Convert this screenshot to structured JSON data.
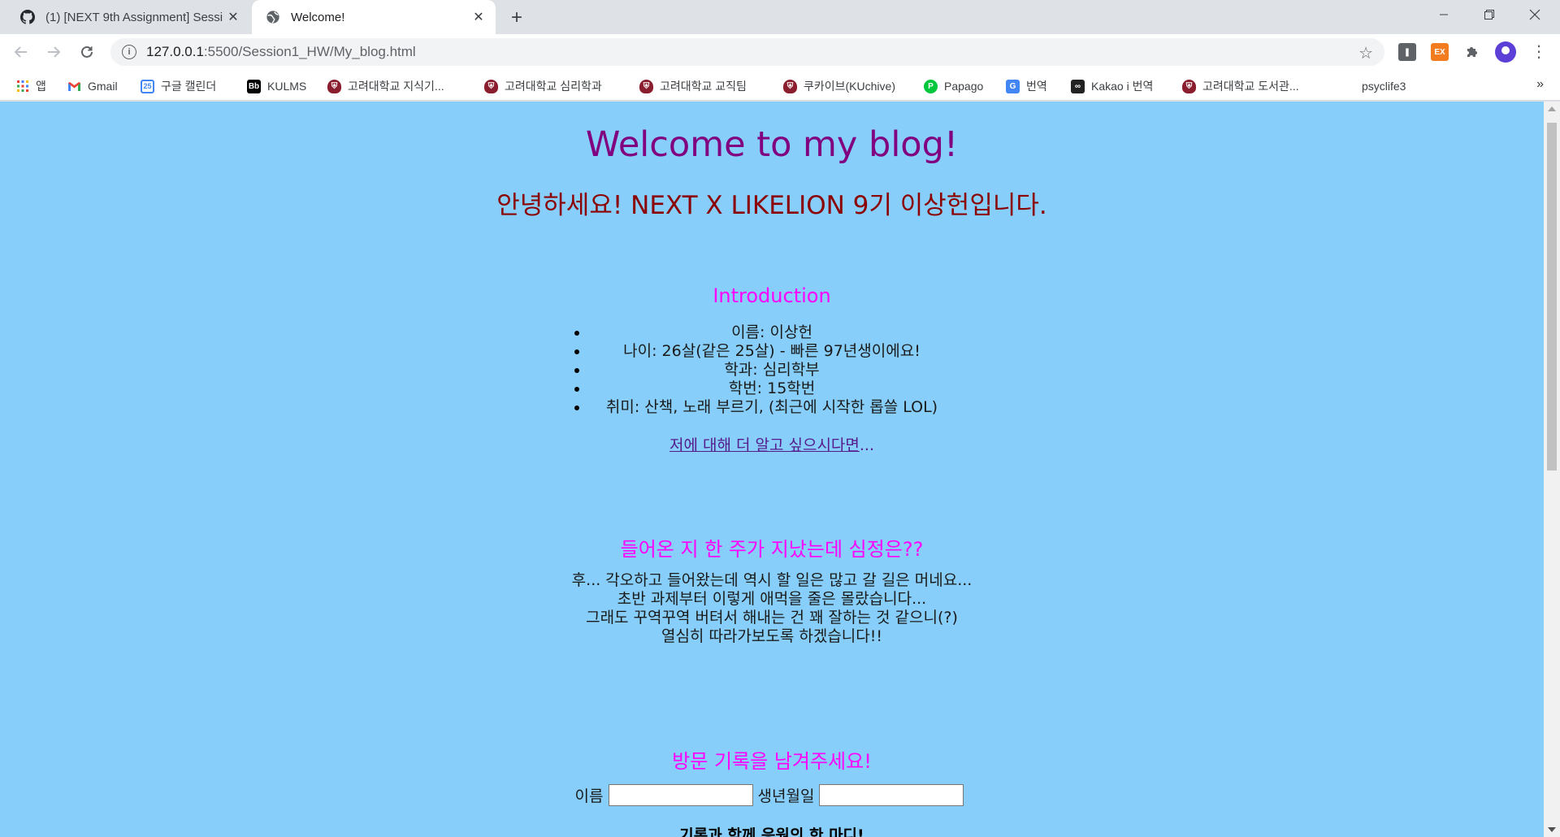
{
  "browser": {
    "tabs": [
      {
        "title": "(1) [NEXT 9th Assignment] Sessi",
        "icon": "github-icon"
      },
      {
        "title": "Welcome!",
        "icon": "globe-icon"
      }
    ],
    "url_host": "127.0.0.1",
    "url_path": ":5500/Session1_HW/My_blog.html",
    "bookmarks": [
      {
        "label": "앱",
        "icon": "apps-grid-icon"
      },
      {
        "label": "Gmail",
        "icon": "gmail-icon"
      },
      {
        "label": "구글 캘린더",
        "icon": "calendar-icon",
        "badge": "25"
      },
      {
        "label": "KULMS",
        "icon": "blackboard-icon",
        "badge": "Bb"
      },
      {
        "label": "고려대학교 지식기...",
        "icon": "korea-univ-icon"
      },
      {
        "label": "고려대학교 심리학과",
        "icon": "korea-univ-icon"
      },
      {
        "label": "고려대학교 교직팀",
        "icon": "korea-univ-icon"
      },
      {
        "label": "쿠카이브(KUchive)",
        "icon": "korea-univ-icon"
      },
      {
        "label": "Papago",
        "icon": "papago-icon"
      },
      {
        "label": "번역",
        "icon": "google-translate-icon"
      },
      {
        "label": "Kakao i 번역",
        "icon": "kakao-translate-icon"
      },
      {
        "label": "고려대학교 도서관...",
        "icon": "korea-univ-library-icon"
      },
      {
        "label": "psyclife3",
        "icon": ""
      }
    ],
    "extension_ex_label": "EX",
    "overflow_label": "»"
  },
  "page": {
    "heading": "Welcome to my blog!",
    "subheading": "안녕하세요! NEXT X LIKELION 9기 이상헌입니다.",
    "intro": {
      "title": "Introduction",
      "items": [
        "이름: 이상헌",
        "나이: 26살(같은 25살) - 빠른 97년생이에요!",
        "학과: 심리학부",
        "학번: 15학번",
        "취미: 산책, 노래 부르기, (최근에 시작한 롭쓸 LOL)"
      ],
      "link_text": "저에 대해 더 알고 싶으시다면",
      "link_suffix": "..."
    },
    "feeling": {
      "title": "들어온 지 한 주가 지났는데 심정은??",
      "lines": [
        "후... 각오하고 들어왔는데 역시 할 일은 많고 갈 길은 머네요...",
        "초반 과제부터 이렇게 애먹을 줄은 몰랐습니다...",
        "그래도 꾸역꾸역 버텨서 해내는 건 꽤 잘하는 것 같으니(?)",
        "열심히 따라가보도록 하겠습니다!!"
      ]
    },
    "visit": {
      "title": "방문 기록을 남겨주세요!",
      "name_label": "이름",
      "name_value": "",
      "birth_label": "생년월일",
      "birth_value": "",
      "cutoff_text": "기록과 함께 응원의 한 마디!"
    }
  },
  "colors": {
    "page_bg": "#87cefa",
    "heading": "#800080",
    "subheading": "#8b0000",
    "section_title": "#ff00ff",
    "link": "#551a8b"
  }
}
